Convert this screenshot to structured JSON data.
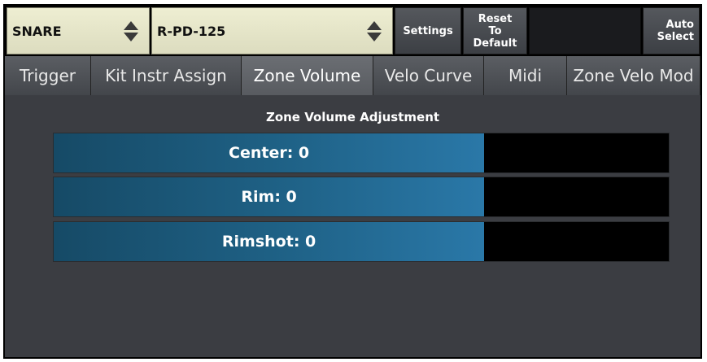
{
  "header": {
    "instrument_select": "SNARE",
    "pad_select": "R-PD-125",
    "settings_label": "Settings",
    "reset_label": "Reset\nTo\nDefault",
    "auto_select_label": "Auto\nSelect"
  },
  "tabs": [
    {
      "label": "Trigger",
      "active": false
    },
    {
      "label": "Kit Instr Assign",
      "active": false
    },
    {
      "label": "Zone Volume",
      "active": true
    },
    {
      "label": "Velo Curve",
      "active": false
    },
    {
      "label": "Midi",
      "active": false
    },
    {
      "label": "Zone Velo Mod",
      "active": false
    }
  ],
  "main": {
    "title": "Zone Volume Adjustment",
    "sliders": [
      {
        "label": "Center: 0",
        "fill_fraction": 0.7
      },
      {
        "label": "Rim: 0",
        "fill_fraction": 0.7
      },
      {
        "label": "Rimshot: 0",
        "fill_fraction": 0.7
      }
    ]
  },
  "colors": {
    "background": "#3b3d42",
    "slider_fill": "#1f6287",
    "selector_bg": "#e6e6cb"
  },
  "icons": {
    "spinner": "up-down-arrows-icon"
  }
}
